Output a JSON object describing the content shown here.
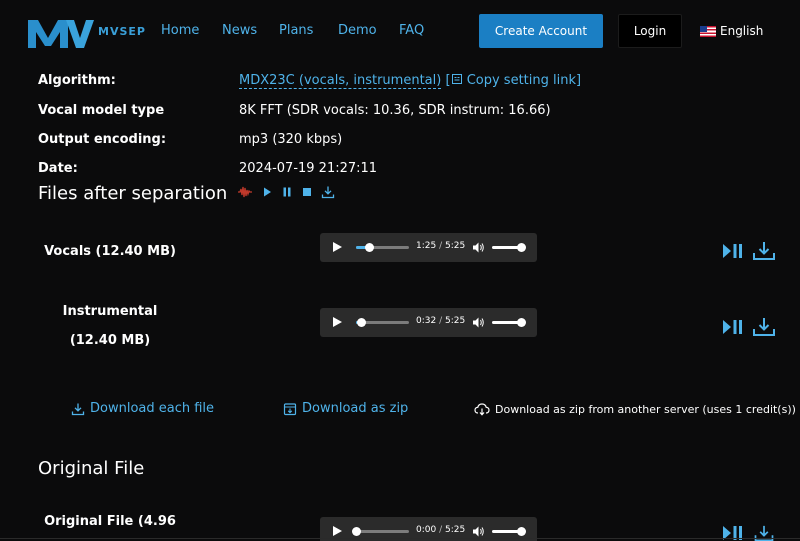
{
  "nav": {
    "logo_text": "MVSEP",
    "links": [
      "Home",
      "News",
      "Plans",
      "Demo",
      "FAQ"
    ],
    "create_account": "Create Account",
    "login": "Login",
    "language": "English"
  },
  "info": {
    "algorithm_label": "Algorithm:",
    "algorithm_value": "MDX23C (vocals, instrumental)",
    "copy_link": "Copy setting link",
    "model_label": "Vocal model type",
    "model_value": "8K FFT (SDR vocals: 10.36, SDR instrum: 16.66)",
    "encoding_label": "Output encoding:",
    "encoding_value": "mp3 (320 kbps)",
    "date_label": "Date:",
    "date_value": "2024-07-19 21:27:11"
  },
  "files_title": "Files after separation",
  "tracks": [
    {
      "name": "Vocals (12.40 MB)",
      "current": "1:25",
      "duration": "5:25",
      "progress": 0.26
    },
    {
      "name": "Instrumental (12.40 MB)",
      "current": "0:32",
      "duration": "5:25",
      "progress": 0.1
    },
    {
      "name": "Original File (4.96",
      "current": "0:00",
      "duration": "5:25",
      "progress": 0.0
    }
  ],
  "downloads": {
    "each": "Download each file",
    "zip": "Download as zip",
    "other_server": "Download as zip from another server (uses 1 credit(s))"
  },
  "original_title": "Original File",
  "colors": {
    "accent": "#4fb3ea",
    "button": "#1b7fc4",
    "background": "#0b0b0c",
    "player": "#2b2b2b",
    "waveform": "#c0392b"
  }
}
